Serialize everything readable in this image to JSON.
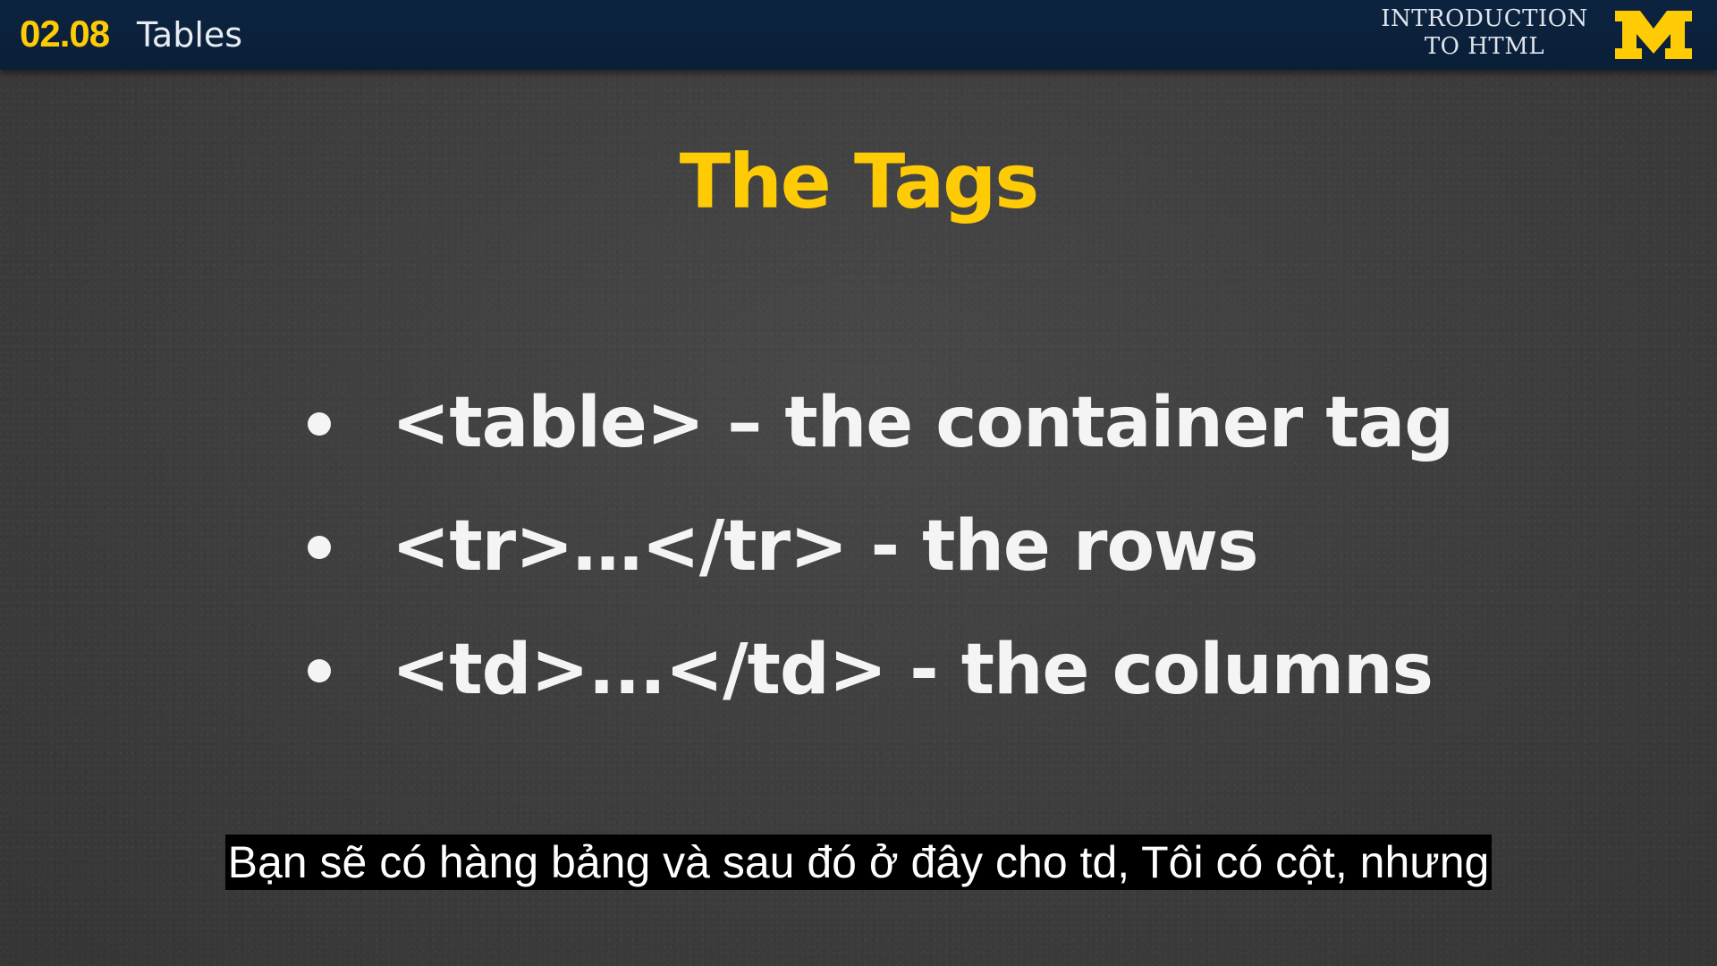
{
  "header": {
    "lesson_number": "02.08",
    "lesson_title": "Tables",
    "course_line1": "INTRODUCTION",
    "course_line2": "TO HTML",
    "logo": "block-m-logo"
  },
  "slide": {
    "title": "The Tags",
    "bullets": [
      "<table> – the container tag",
      "<tr>…</tr> - the rows",
      "<td>...</td> - the columns"
    ]
  },
  "caption": {
    "text": "Bạn sẽ có hàng bảng và sau đó ở đây cho td, Tôi có cột, nhưng"
  },
  "colors": {
    "maize": "#ffcb05",
    "header_blue": "#0c2340",
    "slide_bg": "#3f3f3f",
    "text_white": "#f4f4f4",
    "caption_bg": "#000000"
  }
}
